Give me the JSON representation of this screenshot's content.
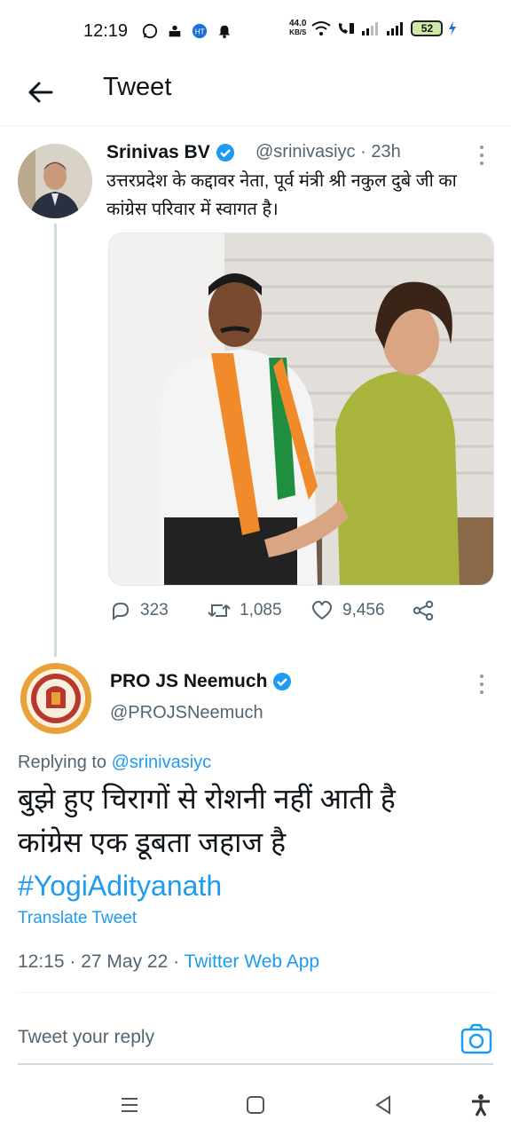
{
  "status_bar": {
    "time": "12:19",
    "net_speed_value": "44.0",
    "net_speed_unit": "KB/S",
    "battery": "52",
    "icons": [
      "whatsapp-icon",
      "app-notification-icon",
      "ht-app-icon",
      "notification-bell-icon",
      "wifi-icon",
      "volte-call-icon",
      "signal-icon",
      "signal-icon",
      "charging-icon"
    ]
  },
  "header": {
    "title": "Tweet",
    "back_icon": "arrow-left-icon"
  },
  "parent_tweet": {
    "name": "Srinivas BV",
    "handle": "@srinivasiyc",
    "time": "· 23h",
    "verified": true,
    "text": "उत्तरप्रदेश के कद्दावर नेता, पूर्व मंत्री श्री नकुल दुबे जी का कांग्रेस परिवार में स्वागत है।",
    "replies": "323",
    "retweets": "1,085",
    "likes": "9,456"
  },
  "reply_tweet": {
    "name": "PRO JS Neemuch",
    "handle": "@PROJSNeemuch",
    "verified": true,
    "replying_prefix": "Replying to",
    "replying_to": "@srinivasiyc",
    "line1": "बुझे हुए चिरागों से रोशनी नहीं आती है",
    "line2": "कांग्रेस एक डूबता जहाज है",
    "hashtag": "#YogiAdityanath",
    "translate": "Translate Tweet",
    "timestamp": "12:15 · 27 May 22 ·",
    "source": "Twitter Web App"
  },
  "reply_bar": {
    "placeholder": "Tweet your reply"
  },
  "colors": {
    "accent": "#1d9bf0",
    "text": "#0f1419",
    "secondary": "#536471",
    "divider": "#eff3f4"
  }
}
